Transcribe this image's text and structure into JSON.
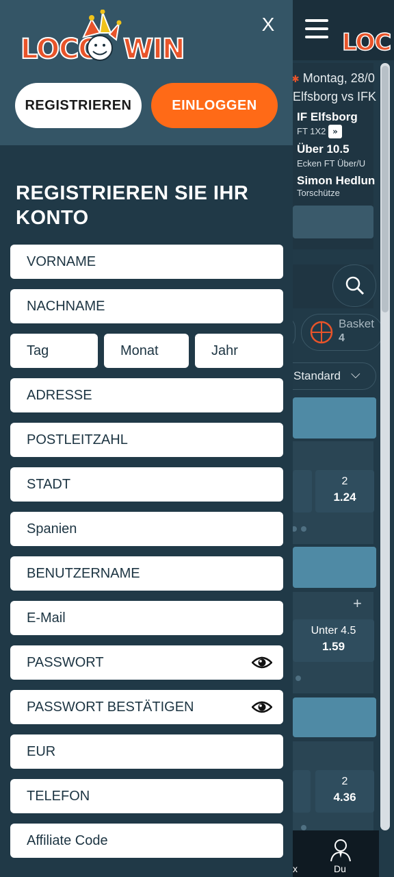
{
  "drawer": {
    "close_label": "X",
    "logo_left": "LOCO",
    "logo_right": "WIN",
    "register_button": "REGISTRIEREN",
    "login_button": "EINLOGGEN",
    "form_title": "REGISTRIEREN SIE IHR KONTO",
    "fields": {
      "first_name": "VORNAME",
      "last_name": "NACHNAME",
      "day": "Tag",
      "month": "Monat",
      "year": "Jahr",
      "address": "ADRESSE",
      "postal_code": "POSTLEITZAHL",
      "city": "STADT",
      "country": "Spanien",
      "username": "BENUTZERNAME",
      "email": "E-Mail",
      "password": "PASSWORT",
      "password_confirm": "PASSWORT BESTÄTIGEN",
      "currency": "EUR",
      "phone": "TELEFON",
      "affiliate_code": "Affiliate Code"
    }
  },
  "background": {
    "logo": "LOC",
    "date": "Montag, 28/0",
    "match": "Elfsborg vs IFK",
    "bets": [
      {
        "selection": "IF Elfsborg",
        "market": "FT 1X2"
      },
      {
        "selection": "Über 10.5",
        "market": "Ecken FT Über/U"
      },
      {
        "selection": "Simon Hedlun",
        "market": "Torschütze"
      }
    ],
    "sport_tab_label": "Basket",
    "sport_tab_count": "4",
    "sort_label": "Standard",
    "odds": [
      {
        "label": "2",
        "value": "1.24"
      },
      {
        "label": "Unter  4.5",
        "value": "1.59"
      },
      {
        "label": "2",
        "value": "4.36"
      }
    ],
    "plus": "+",
    "nav_left_fragment": "x",
    "nav_you_label": "Du"
  },
  "colors": {
    "drawer_header": "#345566",
    "drawer_body": "#203947",
    "accent_orange": "#ff6a17",
    "logo_orange": "#e8542a"
  }
}
